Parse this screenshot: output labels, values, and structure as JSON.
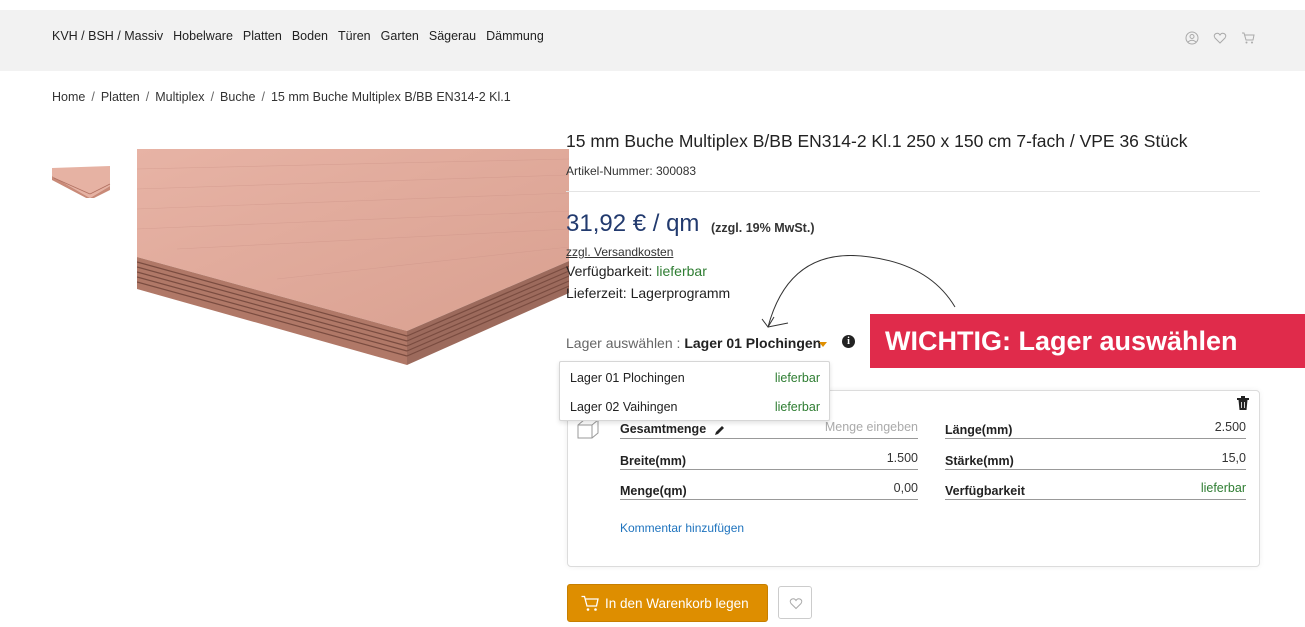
{
  "nav": [
    "KVH / BSH / Massiv",
    "Hobelware",
    "Platten",
    "Boden",
    "Türen",
    "Garten",
    "Sägerau",
    "Dämmung"
  ],
  "header_icons": [
    "user-icon",
    "heart-icon",
    "cart-icon"
  ],
  "breadcrumb": [
    "Home",
    "Platten",
    "Multiplex",
    "Buche",
    "15 mm Buche Multiplex B/BB EN314-2 Kl.1"
  ],
  "product": {
    "title": "15 mm Buche Multiplex B/BB EN314-2 Kl.1 250 x 150 cm 7-fach / VPE 36 Stück",
    "article_number": "Artikel-Nummer: 300083",
    "price": "31,92 € / qm",
    "vat": "(zzgl. 19% MwSt.)",
    "shipping": "zzgl. Versandkosten",
    "availability_label": "Verfügbarkeit: ",
    "availability_value": "lieferbar",
    "lead_time": "Lieferzeit: Lagerprogramm"
  },
  "lager": {
    "label": "Lager auswählen : ",
    "selected": "Lager 01 Plochingen",
    "options": [
      {
        "name": "Lager 01 Plochingen",
        "status": "lieferbar"
      },
      {
        "name": "Lager 02 Vaihingen",
        "status": "lieferbar"
      }
    ]
  },
  "important_banner": "WICHTIG: Lager auswählen",
  "config": {
    "gesamtmenge_label": "Gesamtmenge",
    "gesamtmenge_placeholder": "Menge eingeben",
    "breite_label": "Breite(mm)",
    "breite_value": "1.500",
    "menge_label": "Menge(qm)",
    "menge_value": "0,00",
    "laenge_label": "Länge(mm)",
    "laenge_value": "2.500",
    "staerke_label": "Stärke(mm)",
    "staerke_value": "15,0",
    "verfuegbarkeit_label": "Verfügbarkeit",
    "verfuegbarkeit_value": "lieferbar",
    "comment_link": "Kommentar hinzufügen"
  },
  "buttons": {
    "cart": "In den Warenkorb legen"
  },
  "colors": {
    "accent": "#de8e00",
    "price": "#223a6e",
    "banner": "#e02b4b",
    "available": "#2e7d32",
    "link": "#1e73be"
  }
}
